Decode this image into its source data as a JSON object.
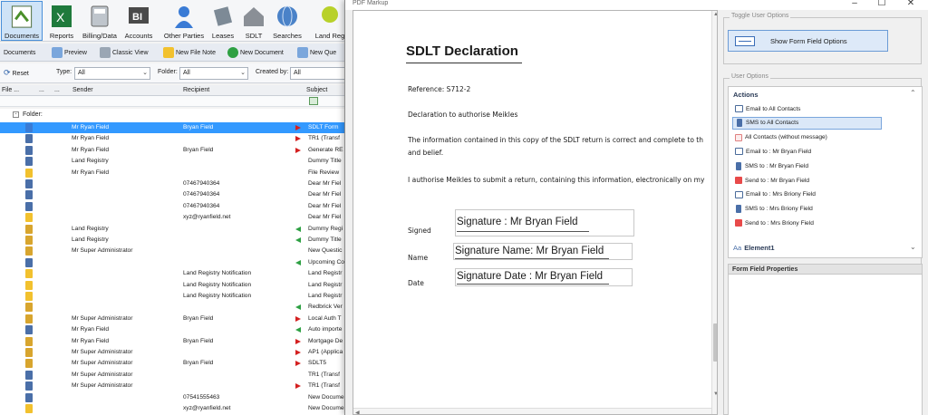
{
  "ribbon": {
    "buttons": [
      "Documents",
      "Reports",
      "Billing/Data",
      "Accounts",
      "Other Parties",
      "Leases",
      "SDLT",
      "Searches",
      "Land Reg"
    ]
  },
  "toolbar": {
    "items": [
      "Documents",
      "Preview",
      "Classic View",
      "New File Note",
      "New Document",
      "New Que"
    ]
  },
  "filters": {
    "reset": "Reset",
    "type_label": "Type:",
    "type_value": "All",
    "folder_label": "Folder:",
    "folder_value": "All",
    "created_label": "Created by:",
    "created_value": "All"
  },
  "grid": {
    "columns": {
      "file": "File ...",
      "dots": "...",
      "dots2": "...",
      "sender": "Sender",
      "recipient": "Recipient",
      "subject": "Subject"
    },
    "group": "Folder:",
    "rows": [
      {
        "sender": "Mr Ryan Field",
        "recipient": "Bryan Field",
        "subject": "SDLT Form",
        "flag": "red",
        "icon": "#3a7bd5",
        "selected": true
      },
      {
        "sender": "Mr Ryan Field",
        "recipient": "",
        "subject": "TR1 (Transf",
        "flag": "red",
        "icon": "#4a6fa8"
      },
      {
        "sender": "Mr Ryan Field",
        "recipient": "Bryan Field",
        "subject": "Generate RE",
        "flag": "red",
        "icon": "#4a6fa8"
      },
      {
        "sender": "Land Registry",
        "recipient": "",
        "subject": "Dummy Title",
        "flag": "",
        "icon": "#4a6fa8"
      },
      {
        "sender": "Mr Ryan Field",
        "recipient": "",
        "subject": "File Review",
        "flag": "",
        "icon": "#f2c12e"
      },
      {
        "sender": "",
        "recipient": "07467940364",
        "subject": "Dear Mr Fiel",
        "flag": "",
        "icon": "#4a6fa8"
      },
      {
        "sender": "",
        "recipient": "07467940364",
        "subject": "Dear Mr Fiel",
        "flag": "",
        "icon": "#4a6fa8"
      },
      {
        "sender": "",
        "recipient": "07467940364",
        "subject": "Dear Mr Fiel",
        "flag": "",
        "icon": "#4a6fa8"
      },
      {
        "sender": "",
        "recipient": "xyz@ryanfield.net",
        "subject": "Dear Mr Fiel",
        "flag": "",
        "icon": "#f2c12e"
      },
      {
        "sender": "Land Registry",
        "recipient": "",
        "subject": "Dummy Regi",
        "flag": "green",
        "icon": "#d8a52e"
      },
      {
        "sender": "Land Registry",
        "recipient": "",
        "subject": "Dummy Title",
        "flag": "green",
        "icon": "#d8a52e"
      },
      {
        "sender": "Mr Super Administrator",
        "recipient": "",
        "subject": "New Questic",
        "flag": "",
        "icon": "#d8a52e"
      },
      {
        "sender": "",
        "recipient": "",
        "subject": "Upcoming Co",
        "flag": "green",
        "icon": "#4a6fa8"
      },
      {
        "sender": "",
        "recipient": "Land Registry Notification",
        "subject": "Land Registr",
        "flag": "",
        "icon": "#f2c12e"
      },
      {
        "sender": "",
        "recipient": "Land Registry Notification",
        "subject": "Land Registr",
        "flag": "",
        "icon": "#f2c12e"
      },
      {
        "sender": "",
        "recipient": "Land Registry Notification",
        "subject": "Land Registr",
        "flag": "",
        "icon": "#f2c12e"
      },
      {
        "sender": "",
        "recipient": "",
        "subject": "Redbrick Ver",
        "flag": "green",
        "icon": "#d8a52e"
      },
      {
        "sender": "Mr Super Administrator",
        "recipient": "Bryan Field",
        "subject": "Local Auth T",
        "flag": "red",
        "icon": "#d8a52e"
      },
      {
        "sender": "Mr Ryan Field",
        "recipient": "",
        "subject": "Auto importe",
        "flag": "green",
        "icon": "#4a6fa8"
      },
      {
        "sender": "Mr Ryan Field",
        "recipient": "Bryan Field",
        "subject": "Mortgage De",
        "flag": "red",
        "icon": "#d8a52e"
      },
      {
        "sender": "Mr Super Administrator",
        "recipient": "",
        "subject": "AP1 (Applica",
        "flag": "red",
        "icon": "#d8a52e"
      },
      {
        "sender": "Mr Super Administrator",
        "recipient": "Bryan Field",
        "subject": "SDLT5",
        "flag": "red",
        "icon": "#d8a52e"
      },
      {
        "sender": "Mr Super Administrator",
        "recipient": "",
        "subject": "TR1 (Transf",
        "flag": "",
        "icon": "#4a6fa8"
      },
      {
        "sender": "Mr Super Administrator",
        "recipient": "",
        "subject": "TR1 (Transf",
        "flag": "red",
        "icon": "#4a6fa8"
      },
      {
        "sender": "",
        "recipient": "07541555463",
        "subject": "New Docume",
        "flag": "",
        "icon": "#4a6fa8"
      },
      {
        "sender": "",
        "recipient": "xyz@ryanfield.net",
        "subject": "New Docume",
        "flag": "",
        "icon": "#f2c12e"
      }
    ]
  },
  "window": {
    "title": "PDF Markup",
    "minimize": "–",
    "maximize": "☐",
    "close": "✕"
  },
  "document": {
    "title": "SDLT Declaration",
    "reference": "Reference: S712-2",
    "declaration": "Declaration to authorise Meikles",
    "para1": "The information contained in this copy of the SDLT return is correct and complete to th",
    "para1b": "and belief.",
    "para2": "I authorise Meikles to submit a return, containing this information, electronically on my",
    "signed_label": "Signed",
    "name_label": "Name",
    "date_label": "Date",
    "sig_signature": "Signature : Mr Bryan Field",
    "sig_name": "Signature Name: Mr Bryan Field",
    "sig_date": "Signature Date : Mr Bryan Field"
  },
  "panel": {
    "toggle_group": "Toggle User Options",
    "show_ff_button": "Show Form Field Options",
    "user_options_group": "User Options",
    "actions_header": "Actions",
    "actions": [
      {
        "label": "Email to All Contacts",
        "type": "email"
      },
      {
        "label": "SMS to All Contacts",
        "type": "sms",
        "selected": true
      },
      {
        "label": "All Contacts (without message)",
        "type": "none"
      },
      {
        "label": "Email to : Mr Bryan Field",
        "type": "email"
      },
      {
        "label": "SMS to : Mr Bryan Field",
        "type": "sms"
      },
      {
        "label": "Send to : Mr Bryan Field",
        "type": "send"
      },
      {
        "label": "Email to : Mrs Briony Field",
        "type": "email"
      },
      {
        "label": "SMS to : Mrs Briony Field",
        "type": "sms"
      },
      {
        "label": "Send to : Mrs Briony Field",
        "type": "send"
      }
    ],
    "element_header": "Element1",
    "element_prefix": "Aa",
    "ffp_header": "Form Field Properties"
  }
}
